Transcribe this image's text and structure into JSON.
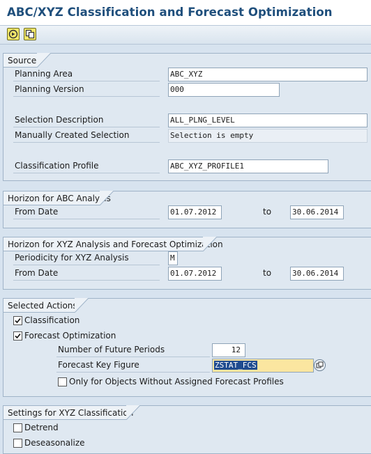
{
  "window": {
    "title": "ABC/XYZ Classification and Forecast Optimization"
  },
  "toolbar": {
    "buttons": [
      "execute-icon",
      "copy-variant-icon"
    ]
  },
  "source": {
    "section_title": "Source",
    "planning_area_label": "Planning Area",
    "planning_area_value": "ABC_XYZ",
    "planning_version_label": "Planning Version",
    "planning_version_value": "000",
    "selection_description_label": "Selection Description",
    "selection_description_value": "ALL_PLNG_LEVEL",
    "manual_selection_label": "Manually Created Selection",
    "manual_selection_value": "Selection is empty",
    "classification_profile_label": "Classification Profile",
    "classification_profile_value": "ABC_XYZ_PROFILE1"
  },
  "abc_horizon": {
    "section_title": "Horizon for ABC Analysis",
    "from_date_label": "From Date",
    "from_date_value": "01.07.2012",
    "to_label": "to",
    "to_date_value": "30.06.2014"
  },
  "xyz_horizon": {
    "section_title": "Horizon for XYZ Analysis and Forecast Optimization",
    "periodicity_label": "Periodicity for XYZ Analysis",
    "periodicity_value": "M",
    "from_date_label": "From Date",
    "from_date_value": "01.07.2012",
    "to_label": "to",
    "to_date_value": "30.06.2014"
  },
  "actions": {
    "section_title": "Selected Actions",
    "classification_label": "Classification",
    "classification_checked": true,
    "forecast_opt_label": "Forecast Optimization",
    "forecast_opt_checked": true,
    "future_periods_label": "Number of Future Periods",
    "future_periods_value": "12",
    "key_figure_label": "Forecast Key Figure",
    "key_figure_value": "ZSTAT_FCS",
    "only_objects_label": "Only for Objects Without Assigned Forecast Profiles",
    "only_objects_checked": false
  },
  "xyz_settings": {
    "section_title": "Settings for XYZ Classification",
    "detrend_label": "Detrend",
    "detrend_checked": false,
    "deseasonalize_label": "Deseasonalize",
    "deseasonalize_checked": false
  },
  "colors": {
    "title": "#1f4f7c",
    "background": "#d7e3ef",
    "highlight": "#1f4b8f",
    "focus_field": "#fbe6a0"
  }
}
